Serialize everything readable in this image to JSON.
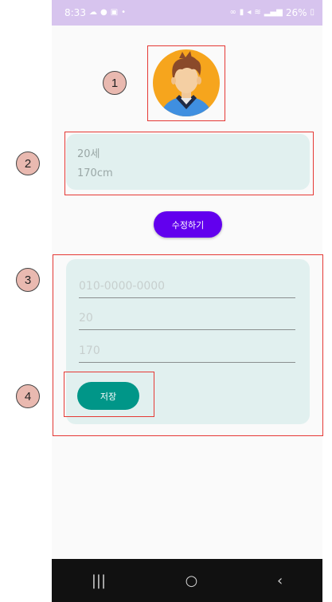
{
  "status_bar": {
    "time": "8:33",
    "battery": "26%",
    "left_icons": [
      "cloud-icon",
      "chat-icon",
      "image-icon",
      "dot-icon"
    ],
    "right_icons": [
      "link-icon",
      "lock-icon",
      "mute-icon",
      "wifi-icon",
      "signal-icon",
      "battery-icon"
    ]
  },
  "profile": {
    "age": "20세",
    "height": "170cm"
  },
  "edit_button_label": "수정하기",
  "form": {
    "phone_placeholder": "010-0000-0000",
    "age_placeholder": "20",
    "height_placeholder": "170",
    "save_button_label": "저장"
  },
  "nav": {
    "recents": "|||",
    "home": "○",
    "back": "‹"
  },
  "annotations": [
    "1",
    "2",
    "3",
    "4"
  ],
  "colors": {
    "status_bar": "#d7c4ee",
    "card": "#e1f0ef",
    "edit_button": "#6200ee",
    "save_button": "#009688",
    "annotation": "#e53935"
  }
}
